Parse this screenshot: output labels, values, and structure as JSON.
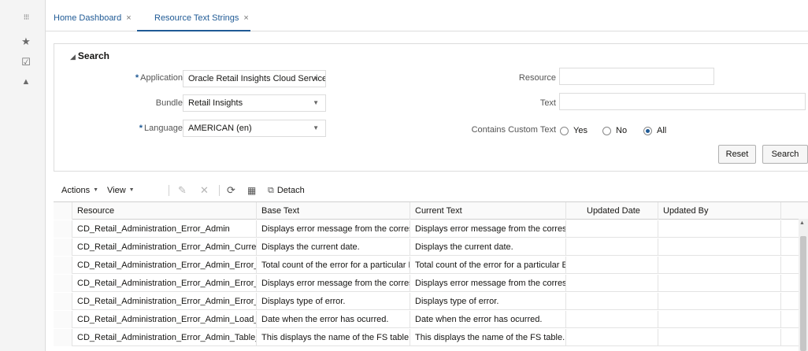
{
  "leftbar": {
    "items": [
      {
        "icon": "apps-grid-icon",
        "glyph": "⁝⁝⁝"
      },
      {
        "icon": "star-icon",
        "glyph": "★"
      },
      {
        "icon": "calendar-check-icon",
        "glyph": "☑"
      },
      {
        "icon": "bell-icon",
        "glyph": "▲"
      }
    ]
  },
  "tabs": [
    {
      "label": "Home Dashboard",
      "close": "×"
    },
    {
      "label": "Resource Text Strings",
      "close": "×"
    }
  ],
  "search": {
    "title": "Search",
    "required_mark": "*",
    "application": {
      "label": "Application",
      "value": "Oracle Retail Insights Cloud Service"
    },
    "bundle": {
      "label": "Bundle",
      "value": "Retail Insights"
    },
    "language": {
      "label": "Language",
      "value": "AMERICAN (en)"
    },
    "resource": {
      "label": "Resource",
      "value": ""
    },
    "text": {
      "label": "Text",
      "value": ""
    },
    "custom_text": {
      "label": "Contains Custom Text",
      "options": [
        "Yes",
        "No",
        "All"
      ],
      "selected": "All"
    },
    "reset_label": "Reset",
    "search_label": "Search"
  },
  "toolbar": {
    "actions_label": "Actions",
    "view_label": "View",
    "detach_label": "Detach"
  },
  "table": {
    "columns": [
      "Resource",
      "Base Text",
      "Current Text",
      "Updated Date",
      "Updated By"
    ],
    "rows": [
      [
        "CD_Retail_Administration_Error_Admin",
        "Displays error message from the corresp",
        "Displays error message from the corresp",
        "",
        ""
      ],
      [
        "CD_Retail_Administration_Error_Admin_Current_",
        "Displays the current date.",
        "Displays the current date.",
        "",
        ""
      ],
      [
        "CD_Retail_Administration_Error_Admin_Error_Cc",
        "Total count of the error for a particular E",
        "Total count of the error for a particular E",
        "",
        ""
      ],
      [
        "CD_Retail_Administration_Error_Admin_Error_M",
        "Displays error message from the corresp",
        "Displays error message from the corresp",
        "",
        ""
      ],
      [
        "CD_Retail_Administration_Error_Admin_Error_Ty",
        "Displays type of error.",
        "Displays type of error.",
        "",
        ""
      ],
      [
        "CD_Retail_Administration_Error_Admin_Load_Da",
        "Date when the error has ocurred.",
        "Date when the error has ocurred.",
        "",
        ""
      ],
      [
        "CD_Retail_Administration_Error_Admin_Table_Na",
        "This displays the name of the FS table.",
        "This displays the name of the FS table.",
        "",
        ""
      ]
    ]
  }
}
